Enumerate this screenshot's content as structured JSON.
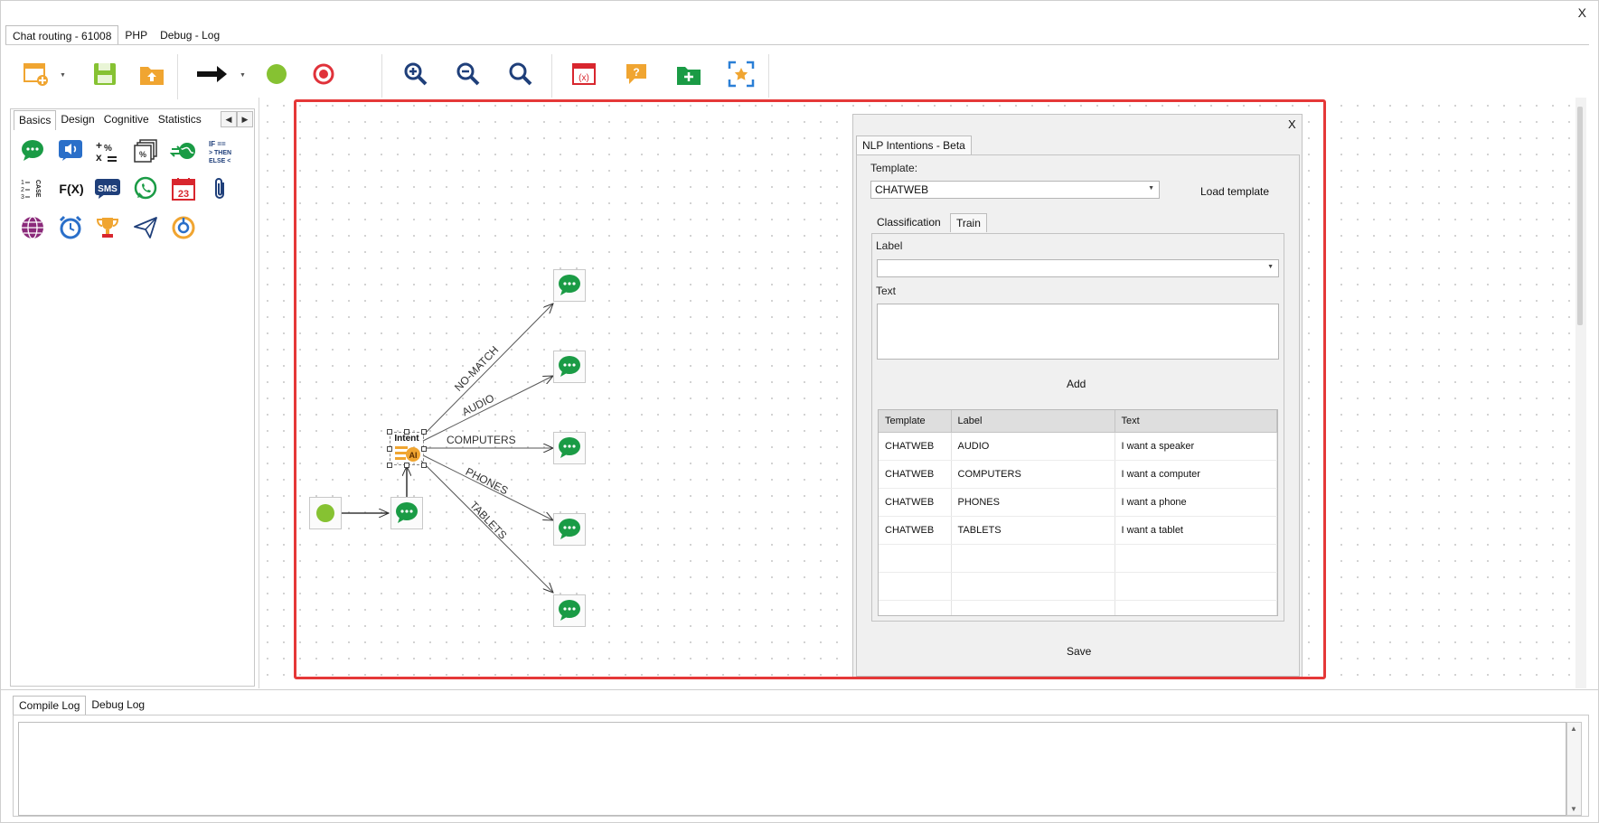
{
  "window": {
    "close_label": "X"
  },
  "main_tabs": [
    {
      "label": "Chat routing - 61008",
      "active": true
    },
    {
      "label": "PHP",
      "active": false
    },
    {
      "label": "Debug - Log",
      "active": false
    }
  ],
  "toolbar": {
    "buttons": [
      {
        "icon": "new-flow-icon"
      },
      {
        "icon": "save-icon"
      },
      {
        "icon": "upload-icon"
      },
      {
        "icon": "arrow-icon"
      },
      {
        "icon": "start-node-icon"
      },
      {
        "icon": "end-node-icon"
      },
      {
        "icon": "zoom-in-icon"
      },
      {
        "icon": "zoom-out-icon"
      },
      {
        "icon": "zoom-reset-icon"
      },
      {
        "icon": "variables-icon"
      },
      {
        "icon": "help-bubble-icon"
      },
      {
        "icon": "add-folder-icon"
      },
      {
        "icon": "fit-screen-icon"
      }
    ],
    "variables_glyph": "(x)",
    "help_glyph": "?"
  },
  "palette": {
    "tabs": [
      "Basics",
      "Design",
      "Cognitive",
      "Statistics"
    ],
    "active_tab": "Basics",
    "glyphs": {
      "fx": "F(X)",
      "sms": "SMS",
      "calendar_day": "23",
      "case": "CASE",
      "if_then": "IF ==\n> THEN\nELSE <"
    }
  },
  "flow": {
    "intent_node_label": "Intent",
    "intent_badge": "AI",
    "edge_labels": [
      "NO-MATCH",
      "AUDIO",
      "COMPUTERS",
      "PHONES",
      "TABLETS"
    ]
  },
  "dialog": {
    "close_label": "X",
    "tab_title": "NLP Intentions - Beta",
    "template_label": "Template:",
    "template_value": "CHATWEB",
    "load_template_button": "Load template",
    "inner_tabs": [
      "Classification",
      "Train"
    ],
    "active_inner_tab": "Train",
    "label_field_label": "Label",
    "label_value": "",
    "text_field_label": "Text",
    "text_value": "",
    "add_button": "Add",
    "table": {
      "columns": [
        "Template",
        "Label",
        "Text"
      ],
      "rows": [
        [
          "CHATWEB",
          "AUDIO",
          "I want a speaker"
        ],
        [
          "CHATWEB",
          "COMPUTERS",
          "I want a computer"
        ],
        [
          "CHATWEB",
          "PHONES",
          "I want a phone"
        ],
        [
          "CHATWEB",
          "TABLETS",
          "I want a tablet"
        ]
      ],
      "empty_rows": 3
    },
    "save_button": "Save"
  },
  "log": {
    "tabs": [
      "Compile Log",
      "Debug Log"
    ],
    "active_tab": "Compile Log",
    "content": ""
  },
  "colors": {
    "highlight_frame": "#e53838",
    "chat_node": "#1a9b45",
    "start_node": "#86c232",
    "end_node": "#e0323a",
    "zoom": "#1f3f7a",
    "folder_orange": "#f0a531"
  }
}
